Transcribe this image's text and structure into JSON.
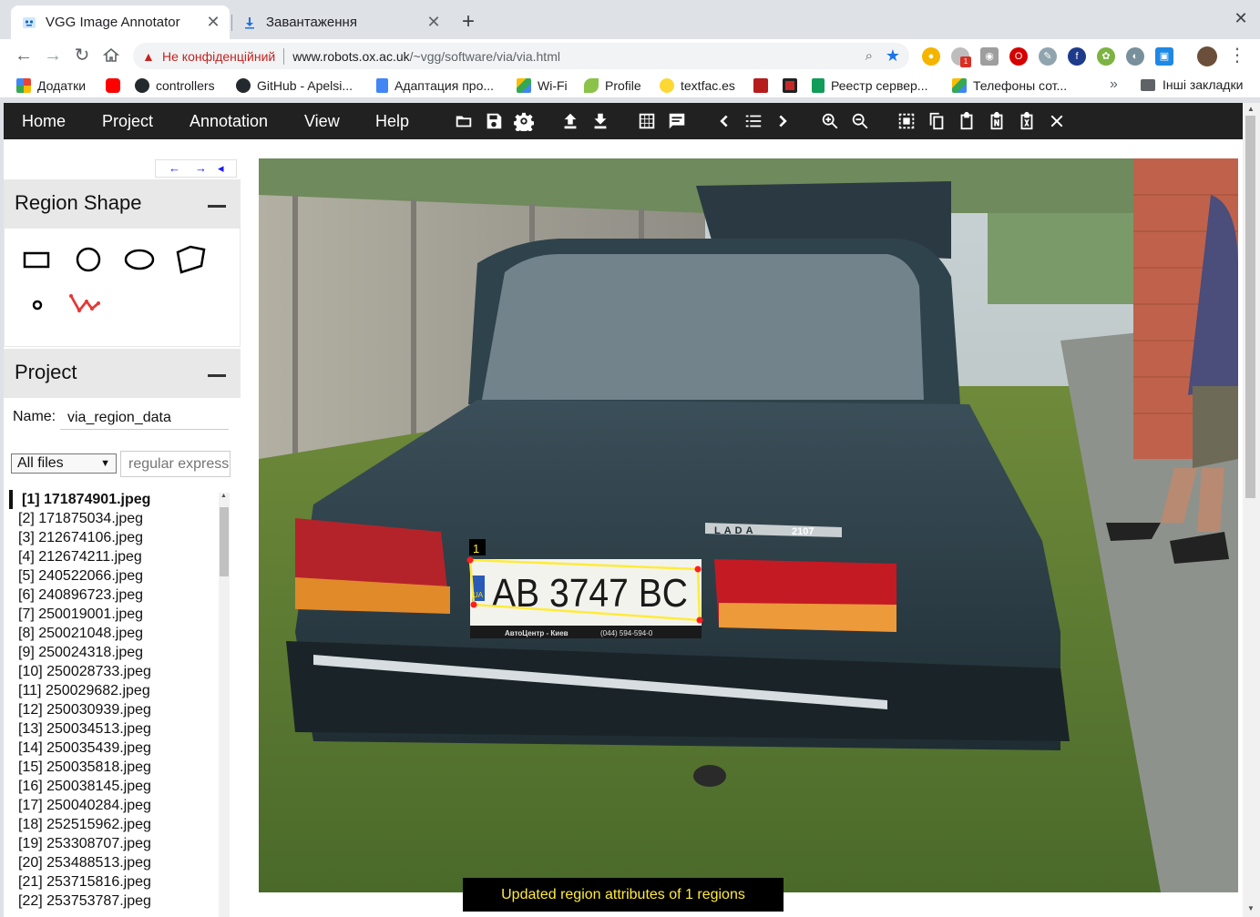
{
  "browser": {
    "tabs": [
      {
        "label": "VGG Image Annotator",
        "active": true
      },
      {
        "label": "Завантаження",
        "active": false
      }
    ],
    "omnibox": {
      "insecure_label": "Не конфіденційний",
      "host": "www.robots.ox.ac.uk",
      "path": "/~vgg/software/via/via.html"
    },
    "extension_badge": "1",
    "bookmarks": [
      {
        "label": "Додатки",
        "icon": "apps-icon"
      },
      {
        "label": "",
        "icon": "youtube-icon"
      },
      {
        "label": "controllers",
        "icon": "github-icon"
      },
      {
        "label": "GitHub - Apelsi...",
        "icon": "github-icon"
      },
      {
        "label": "Адаптация про...",
        "icon": "docs-icon"
      },
      {
        "label": "Wi-Fi",
        "icon": "drive-icon"
      },
      {
        "label": "Profile",
        "icon": "leaf-icon"
      },
      {
        "label": "textfac.es",
        "icon": "smiley-icon"
      },
      {
        "label": "",
        "icon": "up-icon"
      },
      {
        "label": "",
        "icon": "calendar-icon"
      },
      {
        "label": "Реестр сервер...",
        "icon": "sheets-icon"
      },
      {
        "label": "Телефоны сот...",
        "icon": "drive-icon"
      }
    ],
    "bookmarks_more": "»",
    "other_bookmarks": "Інші закладки"
  },
  "via": {
    "menu": [
      "Home",
      "Project",
      "Annotation",
      "View",
      "Help"
    ],
    "panel_nav": {
      "prev": "←",
      "next": "→",
      "collapse": "◂"
    },
    "region_shape": {
      "title": "Region Shape",
      "shapes": [
        "rectangle",
        "circle",
        "ellipse",
        "polygon",
        "point",
        "polyline"
      ],
      "selected": "polyline"
    },
    "project": {
      "title": "Project",
      "name_label": "Name:",
      "name_value": "via_region_data",
      "filter_select": "All files",
      "filter_placeholder": "regular expression",
      "files": [
        "[1] 171874901.jpeg",
        "[2] 171875034.jpeg",
        "[3] 212674106.jpeg",
        "[4] 212674211.jpeg",
        "[5] 240522066.jpeg",
        "[6] 240896723.jpeg",
        "[7] 250019001.jpeg",
        "[8] 250021048.jpeg",
        "[9] 250024318.jpeg",
        "[10] 250028733.jpeg",
        "[11] 250029682.jpeg",
        "[12] 250030939.jpeg",
        "[13] 250034513.jpeg",
        "[14] 250035439.jpeg",
        "[15] 250035818.jpeg",
        "[16] 250038145.jpeg",
        "[17] 250040284.jpeg",
        "[18] 252515962.jpeg",
        "[19] 253308707.jpeg",
        "[20] 253488513.jpeg",
        "[21] 253715816.jpeg",
        "[22] 253753787.jpeg"
      ],
      "current_index": 0
    },
    "image": {
      "region_label": "1",
      "plate_text": "AB 3747 BC",
      "plate_country": "UA",
      "plate_dealer": "АвтоЦентр - Киев",
      "plate_phone": "(044) 594-594-0",
      "car_badge_brand": "LADA",
      "car_badge_model": "2107"
    },
    "message": "Updated region attributes of 1 regions",
    "colors": {
      "accent_region": "#ffeb3b",
      "vertex": "#ff0000",
      "toolbar_bg": "#212121"
    }
  }
}
